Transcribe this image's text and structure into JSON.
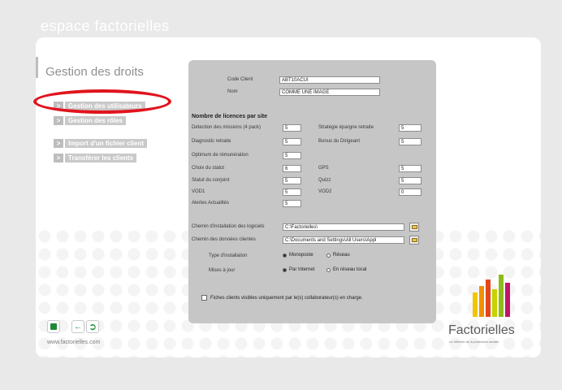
{
  "header": {
    "brand": "espace factorielles"
  },
  "sidebar": {
    "title": "Gestion des droits",
    "items": [
      {
        "label": "Gestion des utilisateurs"
      },
      {
        "label": "Gestion des rôles"
      },
      {
        "label": "Import d'un fichier client"
      },
      {
        "label": "Transférer les clients"
      }
    ]
  },
  "form": {
    "code_client": {
      "label": "Code Client",
      "value": "ABT10ACUI"
    },
    "nom": {
      "label": "Nom",
      "value": "COMME UNE IMAGE"
    },
    "licences_title": "Nombre de licences par site",
    "licences_left": [
      {
        "label": "Détection des missions (4 pack)",
        "value": "5"
      },
      {
        "label": "Diagnostic retraite",
        "value": "5"
      },
      {
        "label": "Optimum de rémunération",
        "value": "5"
      },
      {
        "label": "Choix du statut",
        "value": "6"
      },
      {
        "label": "Statut du conjoint",
        "value": "5"
      },
      {
        "label": "VOD1",
        "value": "5"
      },
      {
        "label": "Alertes Actualités",
        "value": "5"
      }
    ],
    "licences_right": [
      {
        "label": "Stratégie épargne retraite",
        "value": "5"
      },
      {
        "label": "Bonus du Dirigeant",
        "value": "5"
      },
      {
        "label": "GPS",
        "value": "5"
      },
      {
        "label": "Quizz",
        "value": "5"
      },
      {
        "label": "VOD2",
        "value": "0"
      }
    ],
    "install_path": {
      "label": "Chemin d'installation des logiciels",
      "value": "C:\\Factorielles\\"
    },
    "data_path": {
      "label": "Chemin des données clientes",
      "value": "C:\\Documents and Settings\\All Users\\Appl"
    },
    "install_type": {
      "label": "Type d'installation",
      "options": [
        "Monoposte",
        "Réseau"
      ],
      "selected": "Monoposte"
    },
    "updates": {
      "label": "Mises à jour",
      "options": [
        "Par Internet",
        "En réseau local"
      ],
      "selected": "Par Internet"
    },
    "visibility_checkbox": {
      "label": "Fiches clients visibles uniquement par le(s) collaborateur(s) en charge.",
      "checked": false
    }
  },
  "footer": {
    "icons": [
      "save-icon",
      "back-arrow-icon",
      "exit-door-icon"
    ],
    "url": "www.factorielles.com"
  },
  "logo": {
    "name": "Factorielles",
    "tagline": "Le référent de la protection sociale",
    "colors": [
      "#f2c500",
      "#f29100",
      "#e2471b",
      "#c7d301",
      "#8dbb1c",
      "#c2146b"
    ]
  },
  "colors": {
    "highlight_ring": "#e0141c",
    "panel": "#c6c6c6",
    "icon_green": "#1e8a36"
  }
}
